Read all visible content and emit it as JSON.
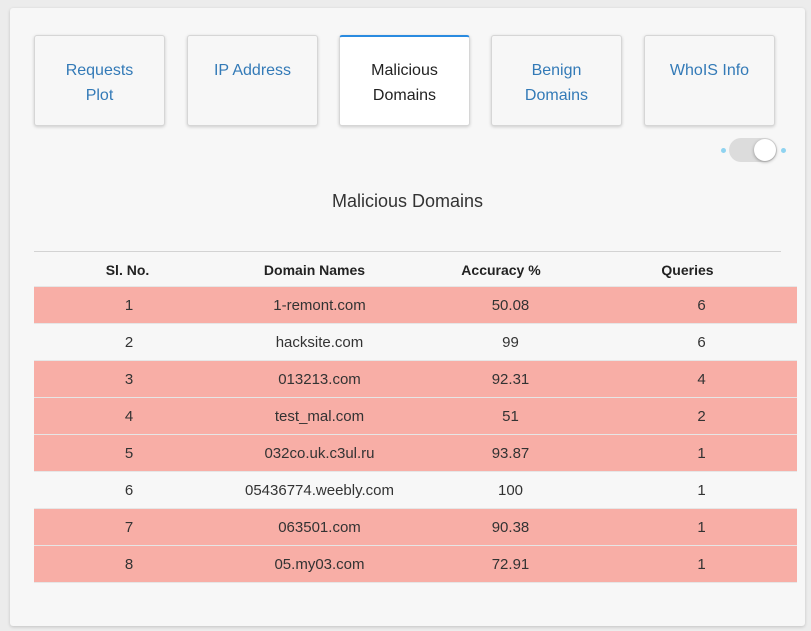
{
  "tabs": [
    {
      "lines": [
        "Requests",
        "Plot"
      ],
      "active": false
    },
    {
      "lines": [
        "IP Address"
      ],
      "active": false
    },
    {
      "lines": [
        "Malicious",
        "Domains"
      ],
      "active": true
    },
    {
      "lines": [
        "Benign",
        "Domains"
      ],
      "active": false
    },
    {
      "lines": [
        "WhoIS Info"
      ],
      "active": false
    }
  ],
  "colors": {
    "link": "#337ab7",
    "active_border": "#2a8be0",
    "malicious_row": "#f8aea6",
    "normal_row": "#f7f7f7",
    "toggle_dot": "#8fd3f0"
  },
  "toggle": {
    "state": "on"
  },
  "section_title": "Malicious Domains",
  "table": {
    "headers": [
      "Sl. No.",
      "Domain Names",
      "Accuracy %",
      "Queries"
    ],
    "rows": [
      {
        "sl": "1",
        "domain": "1-remont.com",
        "accuracy": "50.08",
        "queries": "6",
        "highlight": true
      },
      {
        "sl": "2",
        "domain": "hacksite.com",
        "accuracy": "99",
        "queries": "6",
        "highlight": false
      },
      {
        "sl": "3",
        "domain": "013213.com",
        "accuracy": "92.31",
        "queries": "4",
        "highlight": true
      },
      {
        "sl": "4",
        "domain": "test_mal.com",
        "accuracy": "51",
        "queries": "2",
        "highlight": true
      },
      {
        "sl": "5",
        "domain": "032co.uk.c3ul.ru",
        "accuracy": "93.87",
        "queries": "1",
        "highlight": true
      },
      {
        "sl": "6",
        "domain": "05436774.weebly.com",
        "accuracy": "100",
        "queries": "1",
        "highlight": false
      },
      {
        "sl": "7",
        "domain": "063501.com",
        "accuracy": "90.38",
        "queries": "1",
        "highlight": true
      },
      {
        "sl": "8",
        "domain": "05.my03.com",
        "accuracy": "72.91",
        "queries": "1",
        "highlight": true
      }
    ]
  }
}
